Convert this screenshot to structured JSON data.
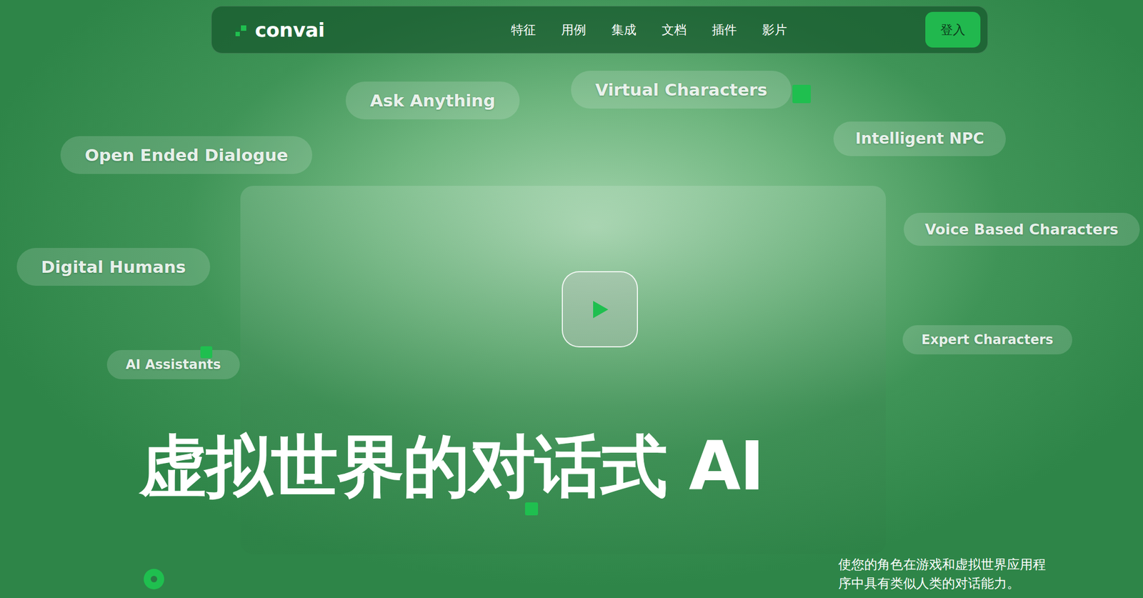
{
  "nav": {
    "logo": "convai",
    "items": [
      "特征",
      "用例",
      "集成",
      "文档",
      "插件",
      "影片"
    ],
    "login": "登入"
  },
  "tags": [
    {
      "label": "Ask Anything"
    },
    {
      "label": "Virtual Characters"
    },
    {
      "label": "Intelligent NPC"
    },
    {
      "label": "Open Ended Dialogue"
    },
    {
      "label": "Voice Based Characters"
    },
    {
      "label": "Digital Humans"
    },
    {
      "label": "Expert Characters"
    },
    {
      "label": "AI Assistants"
    }
  ],
  "hero": {
    "title": "虚拟世界的对话式 AI",
    "subtitle": "使您的角色在游戏和虚拟世界应用程序中具有类似人类的对话能力。"
  }
}
